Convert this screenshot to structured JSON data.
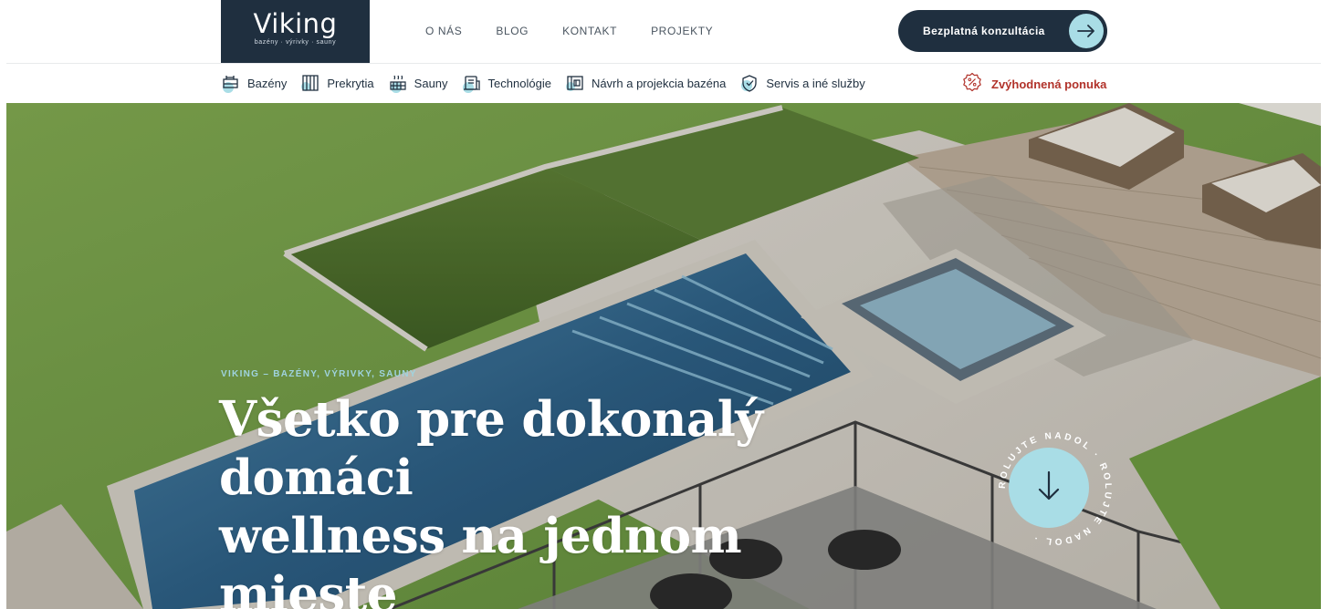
{
  "brand": {
    "name": "Viking",
    "tagline": "bazény · výrivky · sauny",
    "bg_color": "#1f2f3f"
  },
  "main_nav": [
    {
      "label": "O NÁS"
    },
    {
      "label": "BLOG"
    },
    {
      "label": "KONTAKT"
    },
    {
      "label": "PROJEKTY"
    }
  ],
  "cta": {
    "label": "Bezplatná konzultácia",
    "icon": "arrow-right-icon",
    "accent": "#a9dde6"
  },
  "sub_nav": [
    {
      "label": "Bazény",
      "icon": "pool-icon"
    },
    {
      "label": "Prekrytia",
      "icon": "cover-icon"
    },
    {
      "label": "Sauny",
      "icon": "sauna-icon"
    },
    {
      "label": "Technológie",
      "icon": "technology-icon"
    },
    {
      "label": "Návrh a projekcia bazéna",
      "icon": "blueprint-icon"
    },
    {
      "label": "Servis a iné služby",
      "icon": "service-icon"
    }
  ],
  "offer": {
    "label": "Zvýhodnená ponuka",
    "icon": "percent-badge-icon",
    "color": "#b1322a"
  },
  "hero": {
    "eyebrow": "VIKING – BAZÉNY, VÝRIVKY, SAUNY",
    "headline_line1": "Všetko pre dokonalý domáci",
    "headline_line2": "wellness na jednom mieste",
    "scroll_text": "ROLUJTE NADOL · ROLUJTE NADOL ·",
    "scroll_icon": "arrow-down-icon"
  }
}
